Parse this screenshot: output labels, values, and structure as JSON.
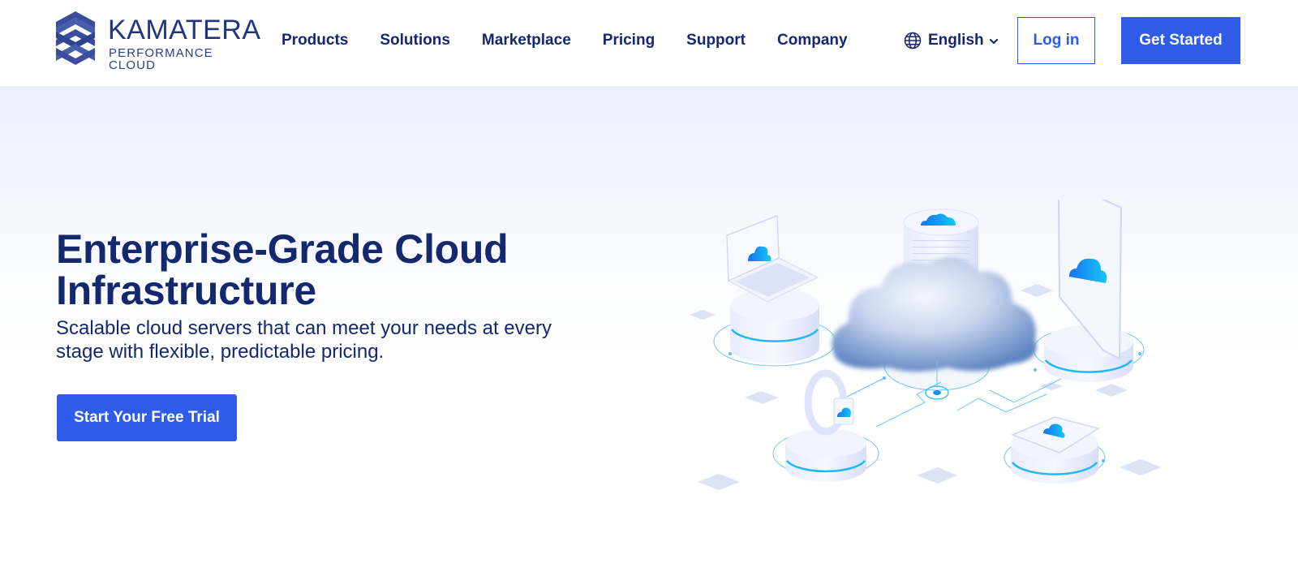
{
  "brand": {
    "name": "KAMATERA",
    "tagline": "PERFORMANCE CLOUD",
    "logo_icon": "stacked-chevron-hexagon-icon"
  },
  "nav": {
    "items": [
      {
        "label": "Products"
      },
      {
        "label": "Solutions"
      },
      {
        "label": "Marketplace"
      },
      {
        "label": "Pricing"
      },
      {
        "label": "Support"
      },
      {
        "label": "Company"
      }
    ],
    "language": {
      "label": "English",
      "icon": "globe-icon",
      "caret_icon": "chevron-down-icon"
    },
    "login_label": "Log in",
    "cta_label": "Get Started"
  },
  "hero": {
    "title": "Enterprise-Grade Cloud Infrastructure",
    "subtitle": "Scalable cloud servers that can meet your needs at every stage with flexible, predictable pricing.",
    "cta_label": "Start Your Free Trial",
    "illustration": {
      "description": "Isometric cloud network illustration",
      "elements": [
        "laptop-on-pedestal",
        "server-cylinder",
        "central-cloud",
        "tablet-on-pedestal",
        "smartwatch-on-pedestal",
        "card-device-on-pedestal"
      ]
    }
  },
  "colors": {
    "primary": "#2e5ce9",
    "navy": "#13286f",
    "logo": "#2b3f88",
    "accent_cyan": "#19b4f0",
    "hero_bg_top": "#e9effd"
  }
}
